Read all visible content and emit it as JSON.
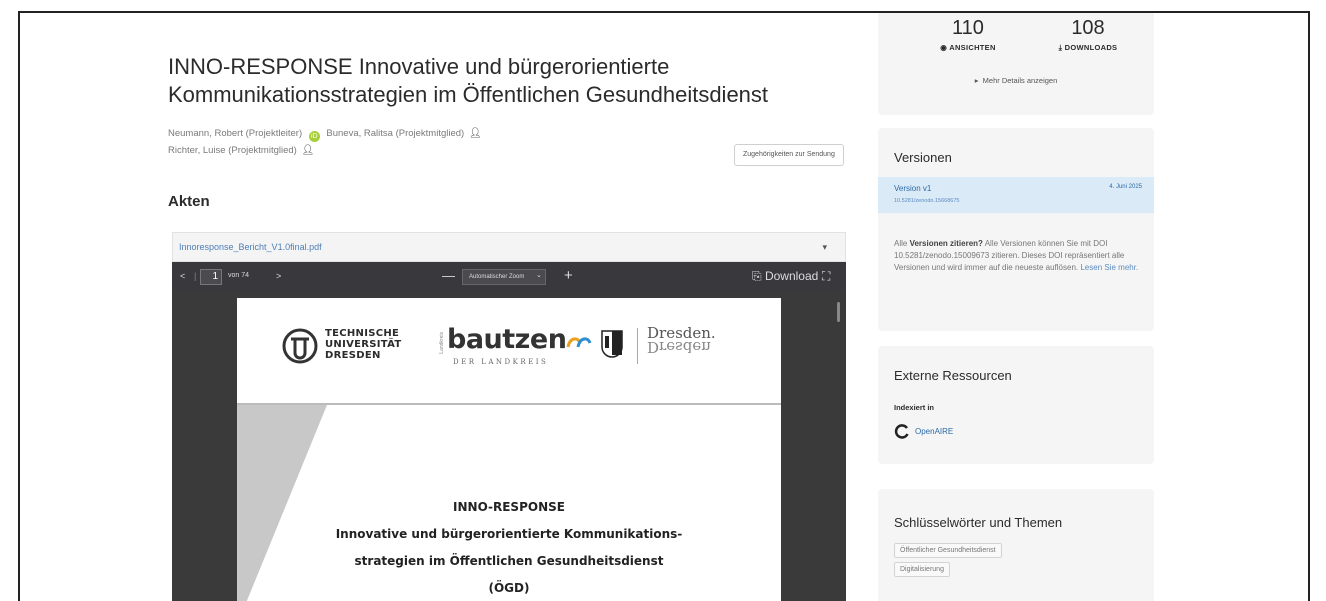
{
  "record": {
    "title": "INNO-RESPONSE Innovative und bürgerorientierte Kommunikationsstrategien im Öffentlichen Gesundheitsdienst",
    "creators": [
      {
        "name": "Neumann, Robert (Projektleiter)",
        "orcid": true
      },
      {
        "name": "Buneva, Ralitsa (Projektmitglied)",
        "orcid": false
      },
      {
        "name": "Richter, Luise (Projektmitglied)",
        "orcid": false
      }
    ],
    "cite_button": "Zugehörigkeiten zur Sendung"
  },
  "files": {
    "heading": "Akten",
    "filename": "Innoresponse_Bericht_V1.0final.pdf",
    "caret": "▾"
  },
  "pdf_viewer": {
    "page_current": "1",
    "page_total": "von 74",
    "zoom": "Automatischer Zoom",
    "download_label": "Download",
    "doc_lines": [
      "INNO-RESPONSE",
      "Innovative und bürgerorientierte Kommunikations-",
      "strategien im Öffentlichen Gesundheitsdienst",
      "(ÖGD)"
    ],
    "logos": {
      "tu": [
        "TECHNISCHE",
        "UNIVERSITÄT",
        "DRESDEN"
      ],
      "bautzen": "bautzen",
      "bautzen_sub": "DER LANDKREIS",
      "bautzen_small": "Landkreis",
      "dresden": [
        "Dresden.",
        "Dresden"
      ]
    }
  },
  "stats": {
    "views": "110",
    "views_label": "ANSICHTEN",
    "downloads": "108",
    "downloads_label": "DOWNLOADS",
    "more_details": "Mehr Details anzeigen"
  },
  "versions": {
    "heading": "Versionen",
    "current_name": "Version v1",
    "current_date": "4. Juni 2025",
    "current_doi": "10.5281/zenodo.15668675",
    "note_prefix": "Alle ",
    "note_bold": "Versionen zitieren?",
    "note_mid": " Alle Versionen können Sie mit DOI 10.5281/zenodo.15009673 zitieren. Dieses DOI repräsentiert alle Versionen und wird immer auf die neueste auflösen. ",
    "note_link": "Lesen Sie mehr."
  },
  "external": {
    "heading": "Externe Ressourcen",
    "indexed_in": "Indexiert in",
    "openaire": "OpenAIRE"
  },
  "keywords": {
    "heading": "Schlüsselwörter und Themen",
    "items": [
      "Öffentlicher Gesundheitsdienst",
      "Digitalisierung"
    ]
  },
  "colors": {
    "link": "#2a6aa8",
    "card_bg": "#f5f5f5",
    "version_highlight": "#dbeaf7",
    "pdf_toolbar": "#38383d",
    "orcid": "#a6ce39"
  }
}
